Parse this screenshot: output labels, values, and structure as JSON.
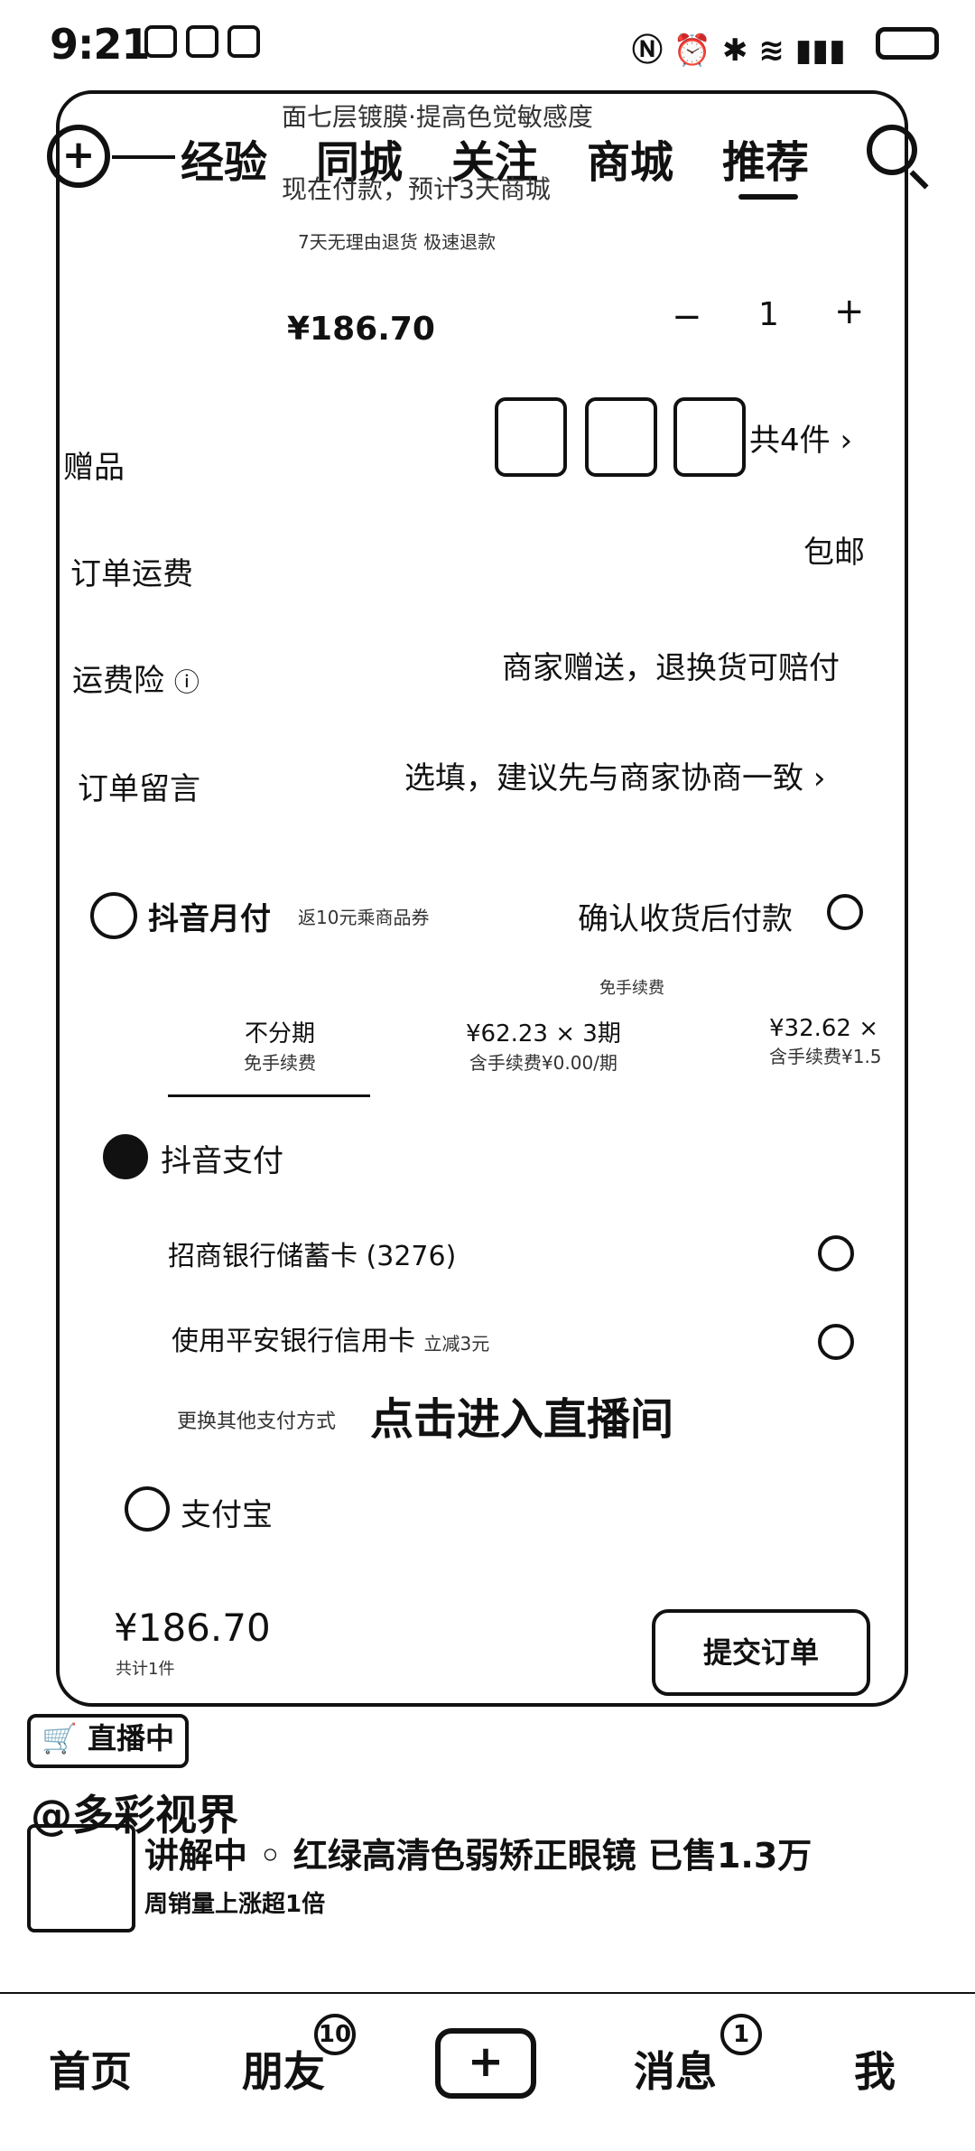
{
  "status_bar": {
    "time": "9:21"
  },
  "top_nav": {
    "tabs": [
      "经验",
      "同城",
      "关注",
      "商城",
      "推荐"
    ],
    "active": "推荐"
  },
  "card": {
    "promo_line1": "面七层镀膜·提高色觉敏感度",
    "promo_line2": "现在付款，预计3天商城",
    "promo_line3": "7天无理由退货  极速退款",
    "price": "¥186.70",
    "qty_minus": "−",
    "qty_value": "1",
    "qty_plus": "+",
    "gift_label": "赠品",
    "gift_count": "共4件",
    "shipping_label": "订单运费",
    "shipping_value": "包邮",
    "insurance_label": "运费险",
    "insurance_value": "商家赠送，退换货可赔付",
    "message_label": "订单留言",
    "message_value": "选填，建议先与商家协商一致",
    "monthly_label": "抖音月付",
    "monthly_promo": "返10元乘商品券",
    "monthly_right": "确认收货后付款",
    "monthly_free": "免手续费",
    "installments": [
      {
        "title": "不分期",
        "sub": "免手续费"
      },
      {
        "title": "¥62.23 × 3期",
        "sub": "含手续费¥0.00/期"
      },
      {
        "title": "¥32.62 ×",
        "sub": "含手续费¥1.5"
      }
    ],
    "douyin_pay_label": "抖音支付",
    "bank1": "招商银行储蓄卡 (3276)",
    "bank2": "使用平安银行信用卡",
    "bank2_promo": "立减3元",
    "more_methods": "更换其他支付方式",
    "alipay_label": "支付宝",
    "footer_price": "¥186.70",
    "footer_sub": "共计1件",
    "submit": "提交订单"
  },
  "live": {
    "enter_room": "点击进入直播间",
    "live_tag": "直播中",
    "username": "@多彩视界",
    "product_line": "讲解中 ◦ 红绿高清色弱矫正眼镜  已售1.3万",
    "product_sub": "周销量上涨超1倍"
  },
  "bottom_nav": {
    "home": "首页",
    "friends": "朋友",
    "friends_badge": "10",
    "plus": "+",
    "messages": "消息",
    "messages_badge": "1",
    "me": "我"
  }
}
